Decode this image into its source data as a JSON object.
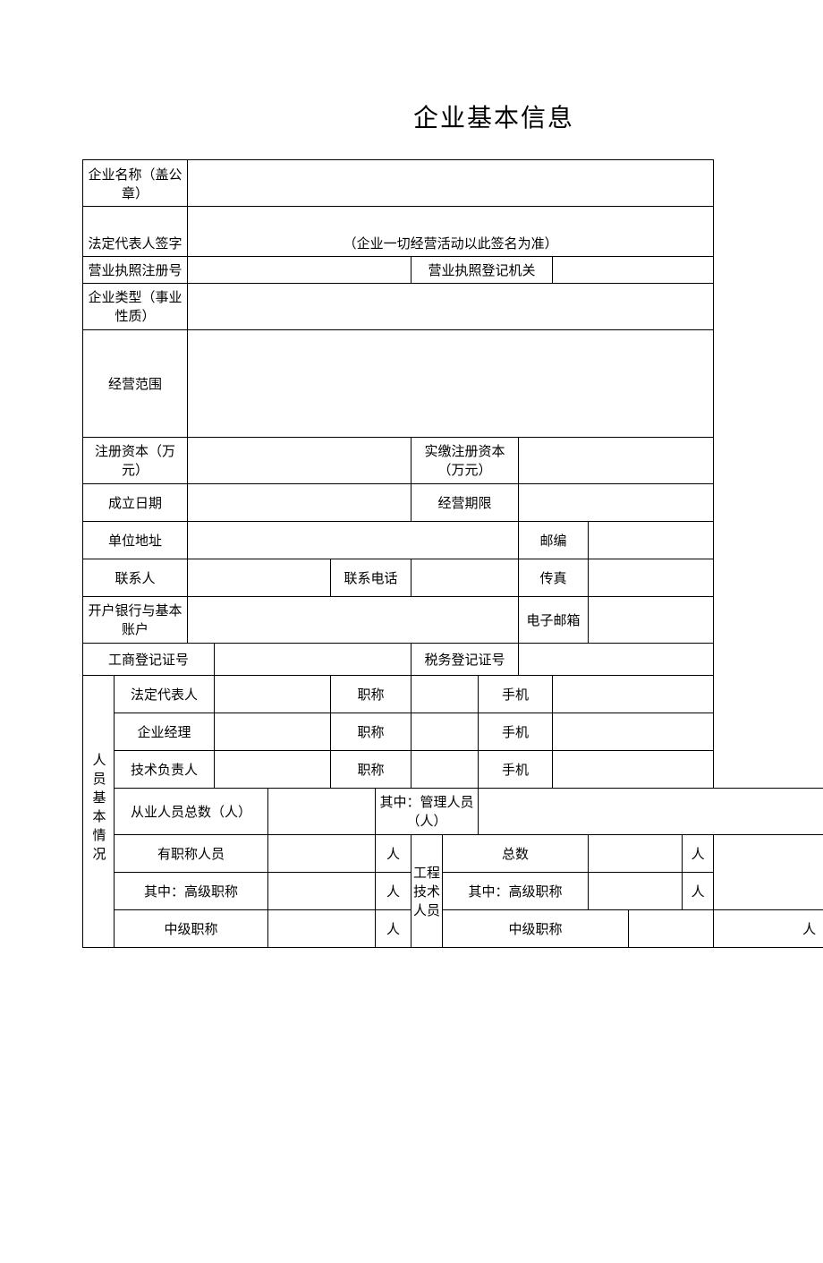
{
  "title": "企业基本信息",
  "r1": "企业名称（盖公章）",
  "r2l": "法定代表人签字",
  "r2note": "（企业一切经营活动以此签名为准）",
  "r3a": "营业执照注册号",
  "r3b": "营业执照登记机关",
  "r4": "企业类型（事业性质）",
  "r5": "经营范围",
  "r6a": "注册资本（万元）",
  "r6b": "实缴注册资本（万元）",
  "r7a": "成立日期",
  "r7b": "经营期限",
  "r8a": "单位地址",
  "r8b": "邮编",
  "r9a": "联系人",
  "r9b": "联系电话",
  "r9c": "传真",
  "r10a": "开户银行与基本账户",
  "r10b": "电子邮箱",
  "r11a": "工商登记证号",
  "r11b": "税务登记证号",
  "sect": "人员基本情况",
  "p1": "法定代表人",
  "p2": "企业经理",
  "p3": "技术负责人",
  "job": "职称",
  "mob": "手机",
  "p4a": "从业人员总数（人）",
  "p4b": "其中：管理人员（人）",
  "p5a": "有职称人员",
  "unit": "人",
  "eng": "工程技术人员",
  "tot": "总数",
  "p6a": "其中：高级职称",
  "p6b": "其中：高级职称",
  "p7a": "中级职称",
  "p7b": "中级职称"
}
